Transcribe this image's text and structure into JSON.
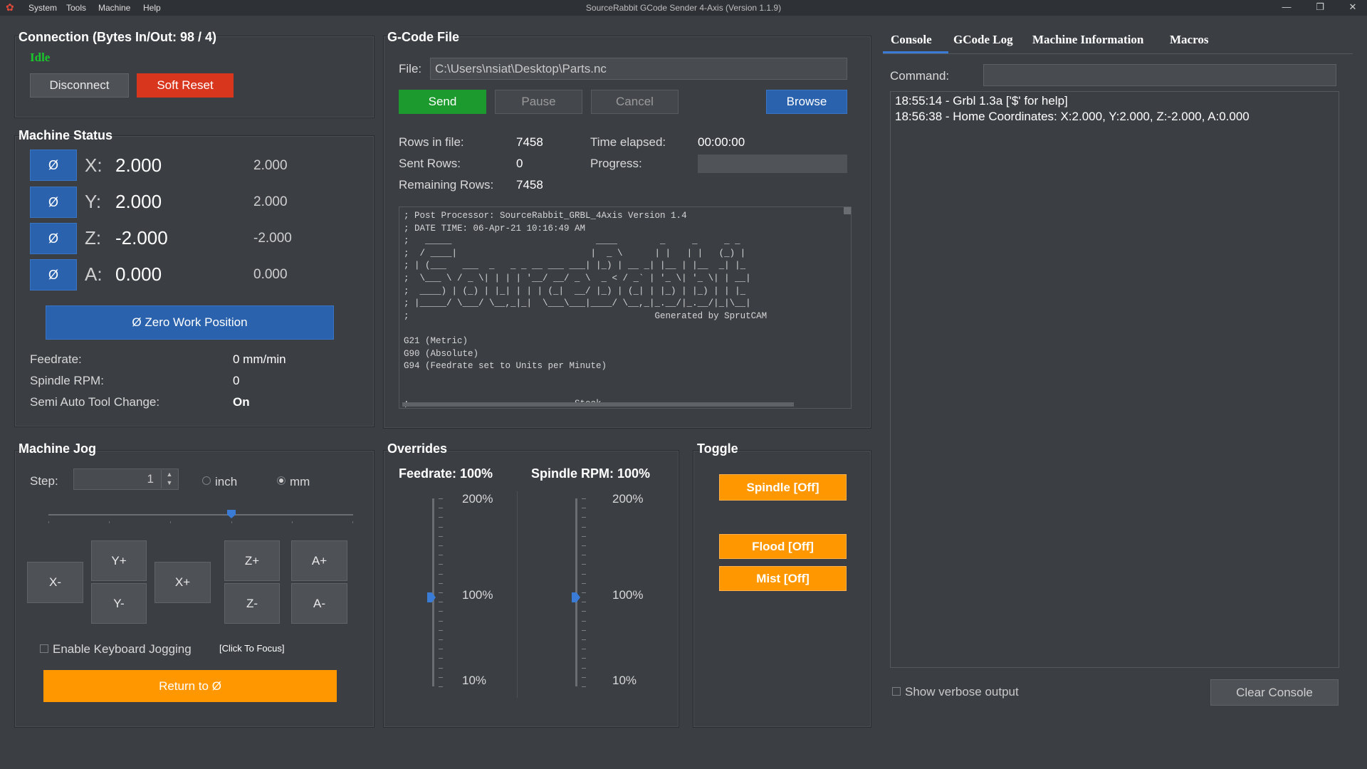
{
  "window": {
    "menu": [
      "System",
      "Tools",
      "Machine",
      "Help"
    ],
    "title": "SourceRabbit GCode Sender 4-Axis (Version 1.1.9)",
    "controls": {
      "minimize": "—",
      "restore": "❐",
      "close": "✕"
    }
  },
  "connection": {
    "title": "Connection (Bytes In/Out: 98 / 4)",
    "state": "Idle",
    "disconnect_label": "Disconnect",
    "soft_reset_label": "Soft Reset"
  },
  "machine_status": {
    "title": "Machine Status",
    "axes": [
      {
        "zero_label": "Ø",
        "letter": "X:",
        "machine": "2.000",
        "work": "2.000"
      },
      {
        "zero_label": "Ø",
        "letter": "Y:",
        "machine": "2.000",
        "work": "2.000"
      },
      {
        "zero_label": "Ø",
        "letter": "Z:",
        "machine": "-2.000",
        "work": "-2.000"
      },
      {
        "zero_label": "Ø",
        "letter": "A:",
        "machine": "0.000",
        "work": "0.000"
      }
    ],
    "zero_work_label": "Ø  Zero Work Position",
    "feedrate_label": "Feedrate:",
    "feedrate_value": "0 mm/min",
    "spindle_label": "Spindle RPM:",
    "spindle_value": "0",
    "tool_change_label": "Semi Auto Tool Change:",
    "tool_change_value": "On"
  },
  "gcode": {
    "title": "G-Code File",
    "file_label": "File:",
    "file_path": "C:\\Users\\nsiat\\Desktop\\Parts.nc",
    "send_label": "Send",
    "pause_label": "Pause",
    "cancel_label": "Cancel",
    "browse_label": "Browse",
    "rows_label": "Rows in file:",
    "rows_value": "7458",
    "sent_label": "Sent Rows:",
    "sent_value": "0",
    "remaining_label": "Remaining Rows:",
    "remaining_value": "7458",
    "elapsed_label": "Time elapsed:",
    "elapsed_value": "00:00:00",
    "progress_label": "Progress:",
    "progress": 0,
    "content": "; Post Processor: SourceRabbit_GRBL_4Axis Version 1.4\n; DATE TIME: 06-Apr-21 10:16:49 AM\n;   _____                           ____        _     _     _ _\n;  / ____|                         |  _ \\      | |   | |   (_) |\n; | (___   ___  _   _ _ __ ___ ___| |_) | __ _| |__ | |__  _| |_\n;  \\___ \\ / _ \\| | | | '__/ __/ _ \\  _ < / _` | '_ \\| '_ \\| | __|\n;  ____) | (_) | |_| | | | (_|  __/ |_) | (_| | |_) | |_) | | |_\n; |_____/ \\___/ \\__,_|_|  \\___\\___|____/ \\__,_|_.__/|_.__/|_|\\__|\n;                                              Generated by SprutCAM\n\nG21 (Metric)\nG90 (Absolute)\nG94 (Feedrate set to Units per Minute)\n\n\n;------------------------------ Stock ------------------------------"
  },
  "jog": {
    "title": "Machine Jog",
    "step_label": "Step:",
    "step_value": "1",
    "unit_inch": "inch",
    "unit_mm": "mm",
    "selected_unit": "mm",
    "buttons": {
      "x_minus": "X-",
      "y_plus": "Y+",
      "y_minus": "Y-",
      "x_plus": "X+",
      "z_plus": "Z+",
      "z_minus": "Z-",
      "a_plus": "A+",
      "a_minus": "A-"
    },
    "keyboard_label": "Enable Keyboard Jogging",
    "focus_label": "[Click To Focus]",
    "return_label": "Return to Ø"
  },
  "overrides": {
    "title": "Overrides",
    "feedrate_label": "Feedrate: 100%",
    "spindle_label": "Spindle RPM: 100%",
    "max_label": "200%",
    "mid_label": "100%",
    "min_label": "10%",
    "feedrate_percent": 100,
    "spindle_percent": 100
  },
  "toggle": {
    "title": "Toggle",
    "spindle_label": "Spindle [Off]",
    "flood_label": "Flood [Off]",
    "mist_label": "Mist [Off]"
  },
  "console": {
    "tabs": [
      "Console",
      "GCode Log",
      "Machine Information",
      "Macros"
    ],
    "active_tab": "Console",
    "command_label": "Command:",
    "lines": [
      "18:55:14 - Grbl 1.3a ['$' for help]",
      "18:56:38 - Home Coordinates: X:2.000, Y:2.000, Z:-2.000, A:0.000"
    ],
    "verbose_label": "Show verbose output",
    "clear_label": "Clear Console"
  },
  "colors": {
    "idle": "#19c62b",
    "accent_blue": "#2a62ad",
    "orange": "#ff9800",
    "red": "#d9361e",
    "green": "#1c9a2d"
  }
}
